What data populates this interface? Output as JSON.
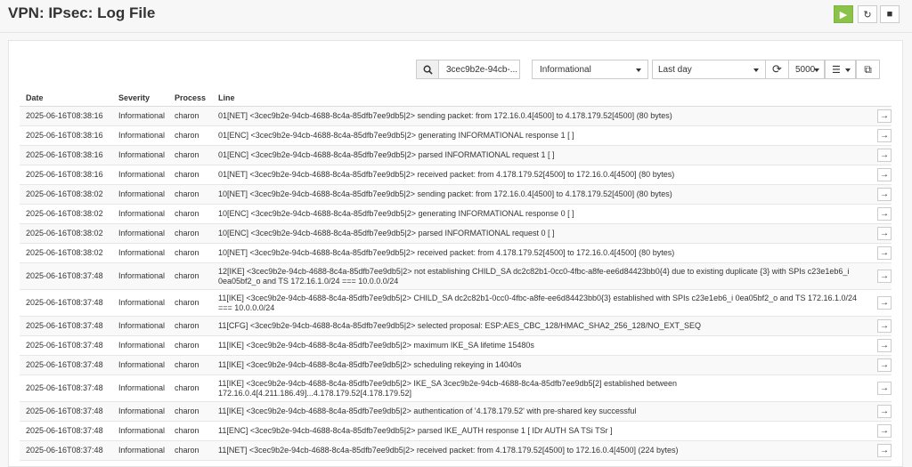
{
  "header": {
    "title": "VPN: IPsec: Log File"
  },
  "header_buttons": {
    "play_icon": "play-icon",
    "reload_icon": "reload-icon",
    "stop_icon": "stop-icon"
  },
  "toolbar": {
    "search_value": "3cec9b2e-94cb-...",
    "severity": "Informational",
    "timespan": "Last day",
    "limit": "5000"
  },
  "table": {
    "columns": [
      "Date",
      "Severity",
      "Process",
      "Line"
    ],
    "rows": [
      {
        "date": "2025-06-16T08:38:16",
        "severity": "Informational",
        "process": "charon",
        "line": "01[NET] <3cec9b2e-94cb-4688-8c4a-85dfb7ee9db5|2> sending packet: from 172.16.0.4[4500] to 4.178.179.52[4500] (80 bytes)"
      },
      {
        "date": "2025-06-16T08:38:16",
        "severity": "Informational",
        "process": "charon",
        "line": "01[ENC] <3cec9b2e-94cb-4688-8c4a-85dfb7ee9db5|2> generating INFORMATIONAL response 1 [ ]"
      },
      {
        "date": "2025-06-16T08:38:16",
        "severity": "Informational",
        "process": "charon",
        "line": "01[ENC] <3cec9b2e-94cb-4688-8c4a-85dfb7ee9db5|2> parsed INFORMATIONAL request 1 [ ]"
      },
      {
        "date": "2025-06-16T08:38:16",
        "severity": "Informational",
        "process": "charon",
        "line": "01[NET] <3cec9b2e-94cb-4688-8c4a-85dfb7ee9db5|2> received packet: from 4.178.179.52[4500] to 172.16.0.4[4500] (80 bytes)"
      },
      {
        "date": "2025-06-16T08:38:02",
        "severity": "Informational",
        "process": "charon",
        "line": "10[NET] <3cec9b2e-94cb-4688-8c4a-85dfb7ee9db5|2> sending packet: from 172.16.0.4[4500] to 4.178.179.52[4500] (80 bytes)"
      },
      {
        "date": "2025-06-16T08:38:02",
        "severity": "Informational",
        "process": "charon",
        "line": "10[ENC] <3cec9b2e-94cb-4688-8c4a-85dfb7ee9db5|2> generating INFORMATIONAL response 0 [ ]"
      },
      {
        "date": "2025-06-16T08:38:02",
        "severity": "Informational",
        "process": "charon",
        "line": "10[ENC] <3cec9b2e-94cb-4688-8c4a-85dfb7ee9db5|2> parsed INFORMATIONAL request 0 [ ]"
      },
      {
        "date": "2025-06-16T08:38:02",
        "severity": "Informational",
        "process": "charon",
        "line": "10[NET] <3cec9b2e-94cb-4688-8c4a-85dfb7ee9db5|2> received packet: from 4.178.179.52[4500] to 172.16.0.4[4500] (80 bytes)"
      },
      {
        "date": "2025-06-16T08:37:48",
        "severity": "Informational",
        "process": "charon",
        "line": "12[IKE] <3cec9b2e-94cb-4688-8c4a-85dfb7ee9db5|2> not establishing CHILD_SA dc2c82b1-0cc0-4fbc-a8fe-ee6d84423bb0{4} due to existing duplicate {3} with SPIs c23e1eb6_i 0ea05bf2_o and TS 172.16.1.0/24 === 10.0.0.0/24"
      },
      {
        "date": "2025-06-16T08:37:48",
        "severity": "Informational",
        "process": "charon",
        "line": "11[IKE] <3cec9b2e-94cb-4688-8c4a-85dfb7ee9db5|2> CHILD_SA dc2c82b1-0cc0-4fbc-a8fe-ee6d84423bb0{3} established with SPIs c23e1eb6_i 0ea05bf2_o and TS 172.16.1.0/24 === 10.0.0.0/24"
      },
      {
        "date": "2025-06-16T08:37:48",
        "severity": "Informational",
        "process": "charon",
        "line": "11[CFG] <3cec9b2e-94cb-4688-8c4a-85dfb7ee9db5|2> selected proposal: ESP:AES_CBC_128/HMAC_SHA2_256_128/NO_EXT_SEQ"
      },
      {
        "date": "2025-06-16T08:37:48",
        "severity": "Informational",
        "process": "charon",
        "line": "11[IKE] <3cec9b2e-94cb-4688-8c4a-85dfb7ee9db5|2> maximum IKE_SA lifetime 15480s"
      },
      {
        "date": "2025-06-16T08:37:48",
        "severity": "Informational",
        "process": "charon",
        "line": "11[IKE] <3cec9b2e-94cb-4688-8c4a-85dfb7ee9db5|2> scheduling rekeying in 14040s"
      },
      {
        "date": "2025-06-16T08:37:48",
        "severity": "Informational",
        "process": "charon",
        "line": "11[IKE] <3cec9b2e-94cb-4688-8c4a-85dfb7ee9db5|2> IKE_SA 3cec9b2e-94cb-4688-8c4a-85dfb7ee9db5[2] established between 172.16.0.4[4.211.186.49]...4.178.179.52[4.178.179.52]"
      },
      {
        "date": "2025-06-16T08:37:48",
        "severity": "Informational",
        "process": "charon",
        "line": "11[IKE] <3cec9b2e-94cb-4688-8c4a-85dfb7ee9db5|2> authentication of '4.178.179.52' with pre-shared key successful"
      },
      {
        "date": "2025-06-16T08:37:48",
        "severity": "Informational",
        "process": "charon",
        "line": "11[ENC] <3cec9b2e-94cb-4688-8c4a-85dfb7ee9db5|2> parsed IKE_AUTH response 1 [ IDr AUTH SA TSi TSr ]"
      },
      {
        "date": "2025-06-16T08:37:48",
        "severity": "Informational",
        "process": "charon",
        "line": "11[NET] <3cec9b2e-94cb-4688-8c4a-85dfb7ee9db5|2> received packet: from 4.178.179.52[4500] to 172.16.0.4[4500] (224 bytes)"
      }
    ]
  }
}
